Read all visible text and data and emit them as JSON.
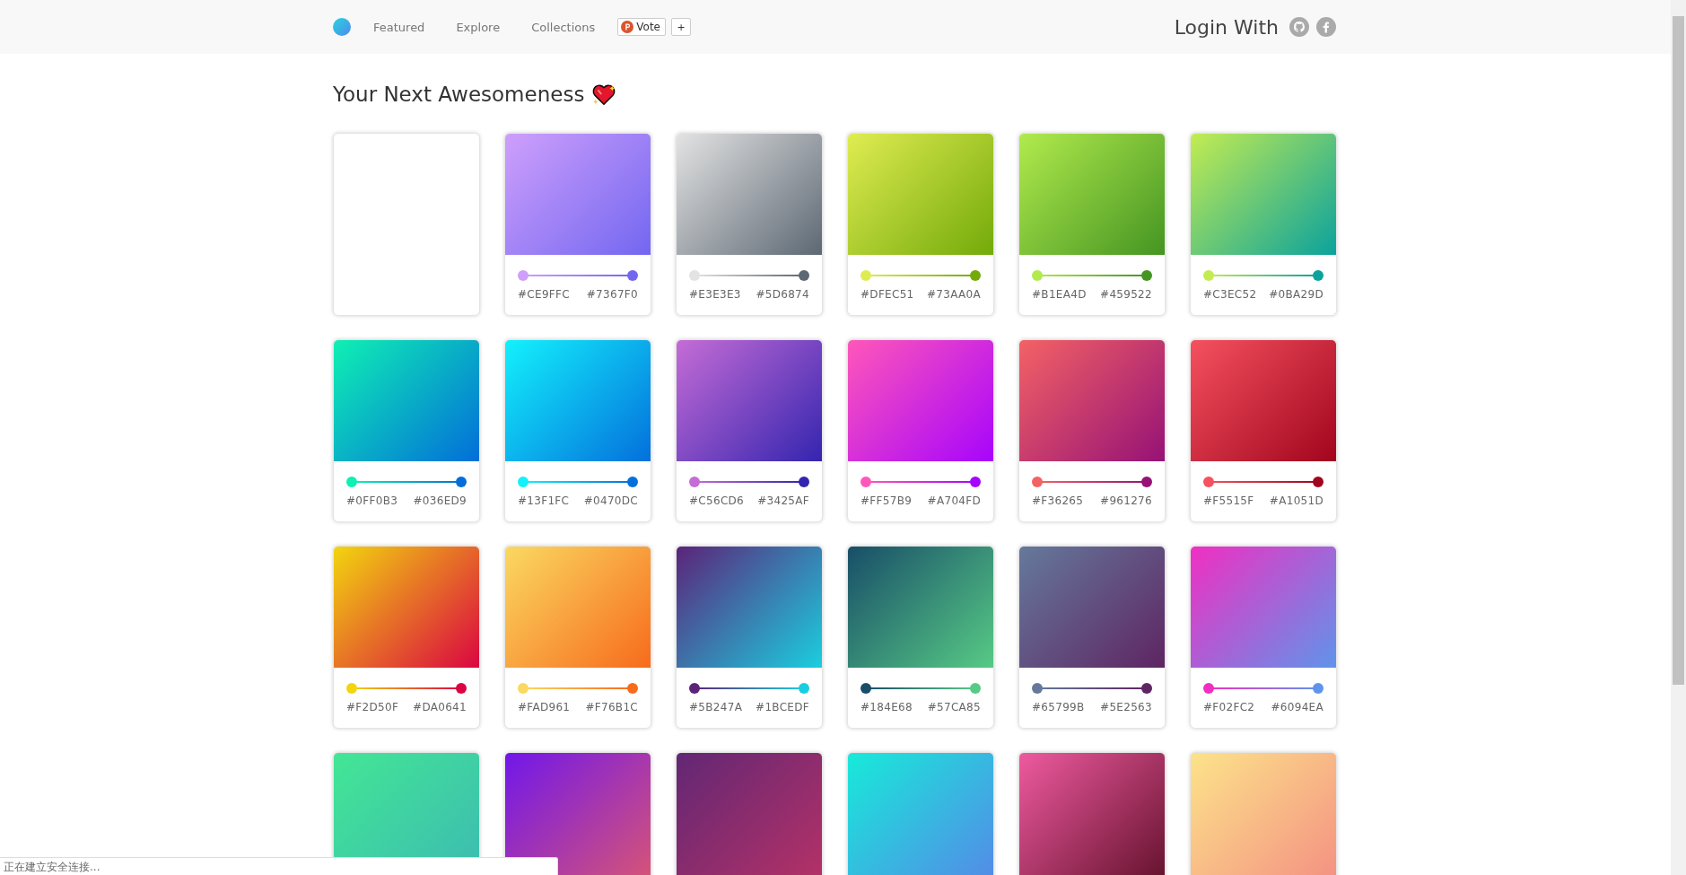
{
  "nav": {
    "links": [
      {
        "label": "Featured"
      },
      {
        "label": "Explore"
      },
      {
        "label": "Collections"
      }
    ],
    "vote": {
      "label": "Vote",
      "plus": "+"
    },
    "login": {
      "label": "Login With"
    }
  },
  "title": "Your Next Awesomeness",
  "cards": [
    {
      "kind": "blank"
    },
    {
      "kind": "swatch",
      "start": "#CE9FFC",
      "end": "#7367F0"
    },
    {
      "kind": "swatch",
      "start": "#E3E3E3",
      "end": "#5D6874"
    },
    {
      "kind": "swatch",
      "start": "#DFEC51",
      "end": "#73AA0A"
    },
    {
      "kind": "swatch",
      "start": "#B1EA4D",
      "end": "#459522"
    },
    {
      "kind": "swatch",
      "start": "#C3EC52",
      "end": "#0BA29D"
    },
    {
      "kind": "swatch",
      "start": "#0FF0B3",
      "end": "#036ED9"
    },
    {
      "kind": "swatch",
      "start": "#13F1FC",
      "end": "#0470DC"
    },
    {
      "kind": "swatch",
      "start": "#C56CD6",
      "end": "#3425AF"
    },
    {
      "kind": "swatch",
      "start": "#FF57B9",
      "end": "#A704FD"
    },
    {
      "kind": "swatch",
      "start": "#F36265",
      "end": "#961276"
    },
    {
      "kind": "swatch",
      "start": "#F5515F",
      "end": "#A1051D"
    },
    {
      "kind": "swatch",
      "start": "#F2D50F",
      "end": "#DA0641"
    },
    {
      "kind": "swatch",
      "start": "#FAD961",
      "end": "#F76B1C"
    },
    {
      "kind": "swatch",
      "start": "#5B247A",
      "end": "#1BCEDF"
    },
    {
      "kind": "swatch",
      "start": "#184E68",
      "end": "#57CA85"
    },
    {
      "kind": "swatch",
      "start": "#65799B",
      "end": "#5E2563"
    },
    {
      "kind": "swatch",
      "start": "#F02FC2",
      "end": "#6094EA"
    },
    {
      "kind": "cropped"
    },
    {
      "kind": "cropped"
    },
    {
      "kind": "cropped"
    },
    {
      "kind": "cropped"
    },
    {
      "kind": "cropped"
    },
    {
      "kind": "cropped"
    }
  ],
  "status_bar": {
    "text": "正在建立安全连接..."
  }
}
